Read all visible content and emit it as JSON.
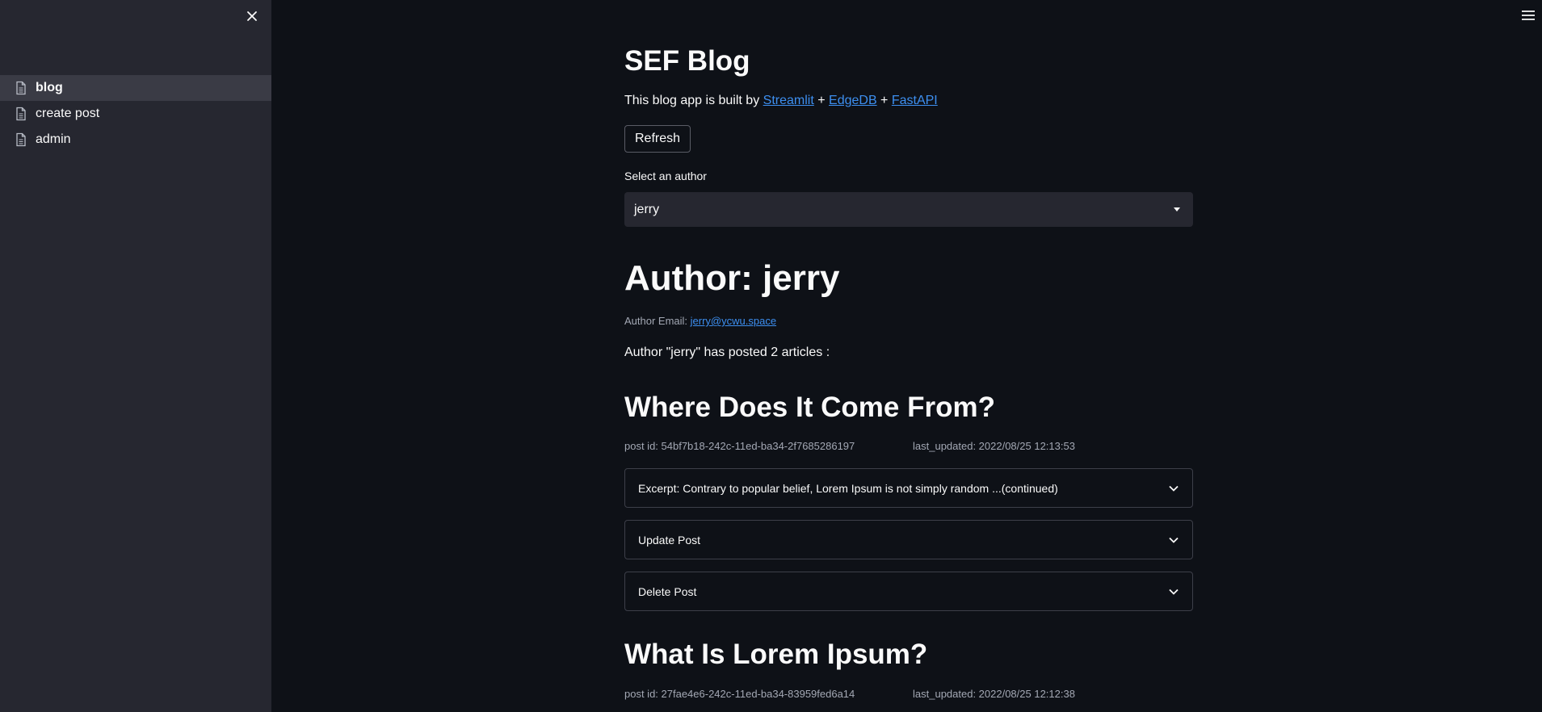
{
  "sidebar": {
    "items": [
      {
        "label": "blog",
        "icon": "document-icon",
        "active": true
      },
      {
        "label": "create post",
        "icon": "document-icon",
        "active": false
      },
      {
        "label": "admin",
        "icon": "document-icon",
        "active": false
      }
    ]
  },
  "main": {
    "title": "SEF Blog",
    "intro": {
      "prefix": "This blog app is built by ",
      "link1": "Streamlit",
      "sep1": " + ",
      "link2": "EdgeDB",
      "sep2": " + ",
      "link3": "FastAPI"
    },
    "refresh_label": "Refresh",
    "select_label": "Select an author",
    "selected_author": "jerry",
    "author_heading": "Author: jerry",
    "author_email_label": "Author Email: ",
    "author_email": "jerry@ycwu.space",
    "author_summary": "Author \"jerry\" has posted 2 articles :",
    "posts": [
      {
        "title": "Where Does It Come From?",
        "post_id": "post id: 54bf7b18-242c-11ed-ba34-2f7685286197",
        "last_updated": "last_updated: 2022/08/25 12:13:53",
        "excerpt": "Excerpt: Contrary to popular belief, Lorem Ipsum is not simply random ...(continued)",
        "update_label": "Update Post",
        "delete_label": "Delete Post"
      },
      {
        "title": "What Is Lorem Ipsum?",
        "post_id": "post id: 27fae4e6-242c-11ed-ba34-83959fed6a14",
        "last_updated": "last_updated: 2022/08/25 12:12:38"
      }
    ]
  },
  "colors": {
    "background": "#0e1117",
    "sidebar": "#262730",
    "link": "#3d8ff0",
    "muted_text": "#a3a8b4"
  }
}
